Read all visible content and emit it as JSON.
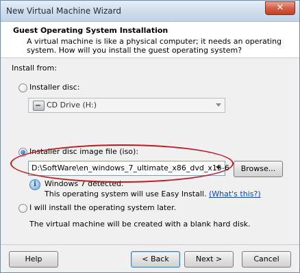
{
  "window": {
    "title": "New Virtual Machine Wizard",
    "close_label": "✕"
  },
  "header": {
    "title": "Guest Operating System Installation",
    "description": "A virtual machine is like a physical computer; it needs an operating system. How will you install the guest operating system?"
  },
  "install": {
    "label": "Install from:",
    "options": [
      {
        "label": "Installer disc:",
        "selected": false,
        "drive_value": "CD Drive (H:)"
      },
      {
        "label": "Installer disc image file (iso):",
        "selected": true,
        "path_value": "D:\\SoftWare\\en_windows_7_ultimate_x86_dvd_x15-6",
        "browse_label": "Browse...",
        "detected_text": "Windows 7 detected.",
        "easy_install_text": "This operating system will use Easy Install.",
        "whats_this_link": "(What's this?)"
      },
      {
        "label": "I will install the operating system later.",
        "selected": false,
        "note": "The virtual machine will be created with a blank hard disk."
      }
    ]
  },
  "footer": {
    "help_label": "Help",
    "back_label": "< Back",
    "next_label": "Next >",
    "cancel_label": "Cancel"
  },
  "colors": {
    "annotation_ellipse": "#c4161c",
    "link": "#0645ad"
  }
}
